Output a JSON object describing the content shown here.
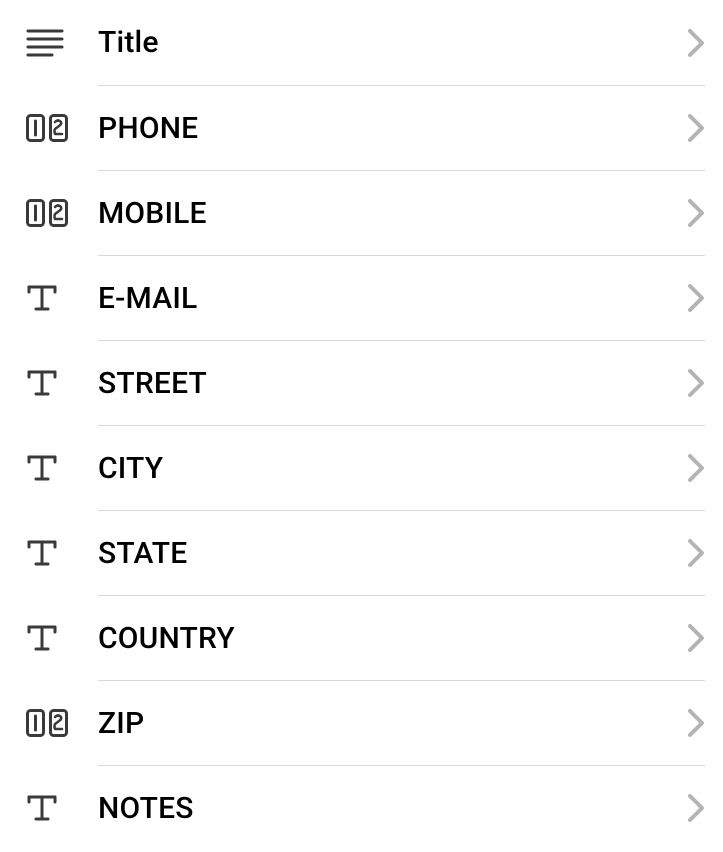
{
  "fields": [
    {
      "label": "Title",
      "icon": "lines",
      "icon_name": "lines-icon"
    },
    {
      "label": "PHONE",
      "icon": "numeric",
      "icon_name": "numeric-icon"
    },
    {
      "label": "MOBILE",
      "icon": "numeric",
      "icon_name": "numeric-icon"
    },
    {
      "label": "E-MAIL",
      "icon": "text",
      "icon_name": "text-icon"
    },
    {
      "label": "STREET",
      "icon": "text",
      "icon_name": "text-icon"
    },
    {
      "label": "CITY",
      "icon": "text",
      "icon_name": "text-icon"
    },
    {
      "label": "STATE",
      "icon": "text",
      "icon_name": "text-icon"
    },
    {
      "label": "COUNTRY",
      "icon": "text",
      "icon_name": "text-icon"
    },
    {
      "label": "ZIP",
      "icon": "numeric",
      "icon_name": "numeric-icon"
    },
    {
      "label": "NOTES",
      "icon": "text",
      "icon_name": "text-icon"
    }
  ]
}
